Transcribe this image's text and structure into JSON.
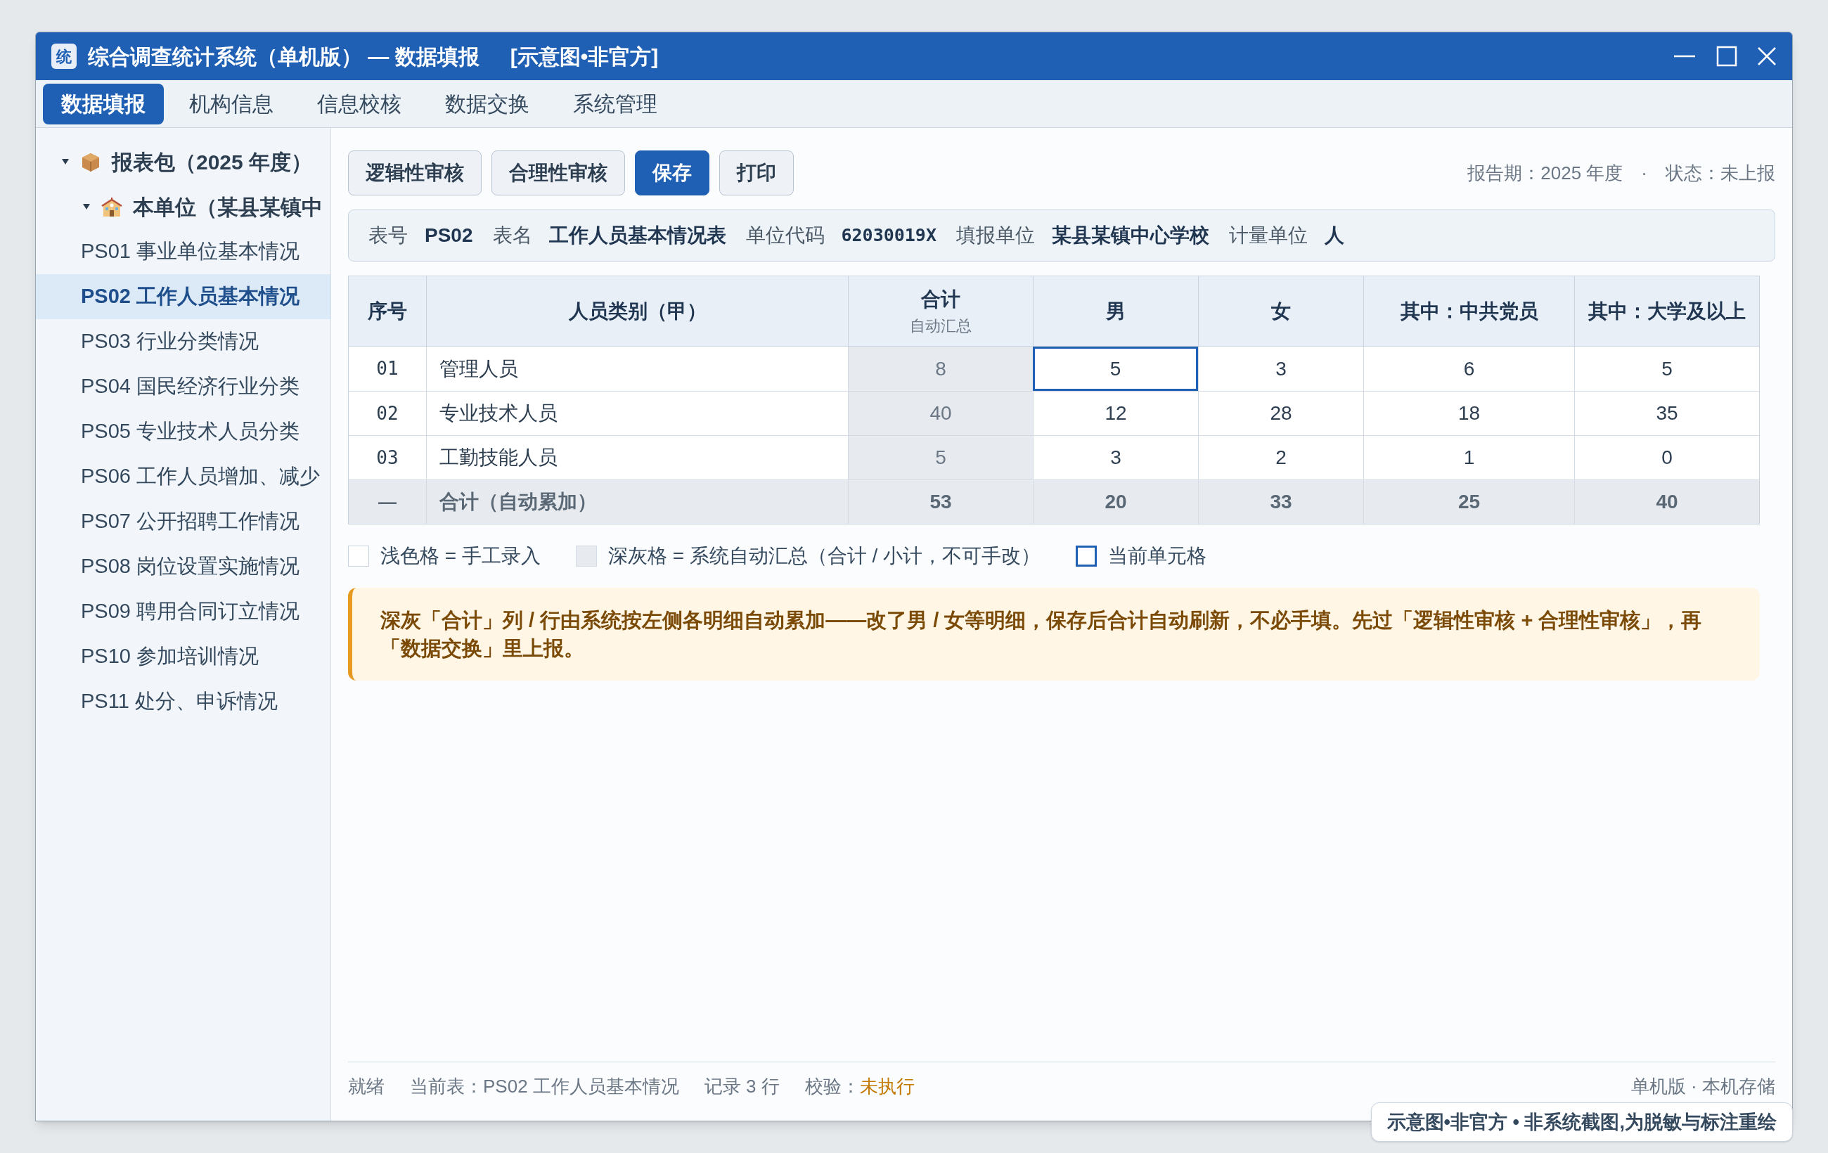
{
  "window": {
    "icon_text": "统",
    "title": "综合调查统计系统（单机版） — 数据填报",
    "tag": "[示意图•非官方]"
  },
  "menu": [
    {
      "label": "数据填报",
      "selected": true
    },
    {
      "label": "机构信息",
      "selected": false
    },
    {
      "label": "信息校核",
      "selected": false
    },
    {
      "label": "数据交换",
      "selected": false
    },
    {
      "label": "系统管理",
      "selected": false
    }
  ],
  "sidebar": {
    "tree": [
      {
        "label": "报表包（2025 年度）",
        "kind": "package",
        "expanded": true,
        "children": [
          {
            "label": "本单位（某县某镇中",
            "kind": "school",
            "expanded": true,
            "children": [
              {
                "label": "PS01 事业单位基本情况",
                "selected": false
              },
              {
                "label": "PS02 工作人员基本情况",
                "selected": true
              },
              {
                "label": "PS03 行业分类情况",
                "selected": false
              },
              {
                "label": "PS04 国民经济行业分类",
                "selected": false
              },
              {
                "label": "PS05 专业技术人员分类",
                "selected": false
              },
              {
                "label": "PS06 工作人员增加、减少",
                "selected": false
              },
              {
                "label": "PS07 公开招聘工作情况",
                "selected": false
              },
              {
                "label": "PS08 岗位设置实施情况",
                "selected": false
              },
              {
                "label": "PS09 聘用合同订立情况",
                "selected": false
              },
              {
                "label": "PS10 参加培训情况",
                "selected": false
              },
              {
                "label": "PS11 处分、申诉情况",
                "selected": false
              }
            ]
          }
        ]
      }
    ]
  },
  "toolbar": {
    "buttons": [
      {
        "label": "逻辑性审核",
        "kind": "default"
      },
      {
        "label": "合理性审核",
        "kind": "default"
      },
      {
        "label": "保存",
        "kind": "primary"
      },
      {
        "label": "打印",
        "kind": "default"
      }
    ],
    "period": "报告期：2025 年度",
    "separator": "·",
    "status": "状态：未上报"
  },
  "info": [
    {
      "label": "表号",
      "value": "PS02",
      "kind": "text"
    },
    {
      "label": "表名",
      "value": "工作人员基本情况表",
      "kind": "text"
    },
    {
      "label": "单位代码",
      "value": "62030019X",
      "kind": "code"
    },
    {
      "label": "填报单位",
      "value": "某县某镇中心学校",
      "kind": "text"
    },
    {
      "label": "计量单位",
      "value": "人",
      "kind": "text"
    }
  ],
  "table": {
    "columns": [
      {
        "label": "序号"
      },
      {
        "label": "人员类别（甲）"
      },
      {
        "label": "合计",
        "note": "自动汇总"
      },
      {
        "label": "男"
      },
      {
        "label": "女"
      },
      {
        "label": "其中：中共党员"
      },
      {
        "label": "其中：大学及以上"
      }
    ],
    "rows": [
      {
        "kind": "detail",
        "cells": [
          {
            "value": "01",
            "current": false
          },
          {
            "value": "管理人员",
            "current": false
          },
          {
            "value": "8",
            "current": false
          },
          {
            "value": "5",
            "current": true
          },
          {
            "value": "3",
            "current": false
          },
          {
            "value": "6",
            "current": false
          },
          {
            "value": "5",
            "current": false
          }
        ]
      },
      {
        "kind": "detail",
        "cells": [
          {
            "value": "02",
            "current": false
          },
          {
            "value": "专业技术人员",
            "current": false
          },
          {
            "value": "40",
            "current": false
          },
          {
            "value": "12",
            "current": false
          },
          {
            "value": "28",
            "current": false
          },
          {
            "value": "18",
            "current": false
          },
          {
            "value": "35",
            "current": false
          }
        ]
      },
      {
        "kind": "detail",
        "cells": [
          {
            "value": "03",
            "current": false
          },
          {
            "value": "工勤技能人员",
            "current": false
          },
          {
            "value": "5",
            "current": false
          },
          {
            "value": "3",
            "current": false
          },
          {
            "value": "2",
            "current": false
          },
          {
            "value": "1",
            "current": false
          },
          {
            "value": "0",
            "current": false
          }
        ]
      },
      {
        "kind": "sum",
        "cells": [
          {
            "value": "—",
            "current": false
          },
          {
            "value": "合计（自动累加）",
            "current": false
          },
          {
            "value": "53",
            "current": false
          },
          {
            "value": "20",
            "current": false
          },
          {
            "value": "33",
            "current": false
          },
          {
            "value": "25",
            "current": false
          },
          {
            "value": "40",
            "current": false
          }
        ]
      }
    ]
  },
  "legend": [
    {
      "kind": "manual",
      "label": "浅色格 = 手工录入"
    },
    {
      "kind": "auto",
      "label": "深灰格 = 系统自动汇总（合计 / 小计，不可手改）"
    },
    {
      "kind": "current",
      "label": "当前单元格"
    }
  ],
  "note": "深灰「合计」列 / 行由系统按左侧各明细自动累加——改了男 / 女等明细，保存后合计自动刷新，不必手填。先过「逻辑性审核 + 合理性审核」，再「数据交换」里上报。",
  "status_bar": {
    "ready": "就绪",
    "current_table": "当前表：PS02 工作人员基本情况",
    "records": "记录 3 行",
    "check_label": "校验：",
    "check_value": "未执行",
    "right": "单机版 · 本机存储"
  },
  "badge": "示意图•非官方 • 非系统截图,为脱敏与标注重绘"
}
